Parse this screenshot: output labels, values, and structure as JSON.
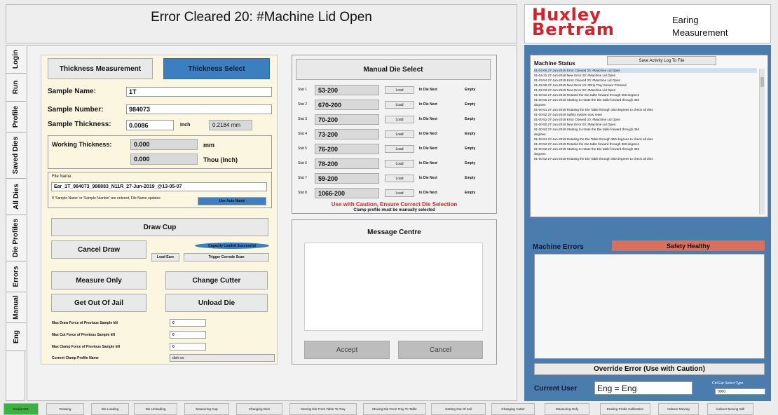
{
  "title": "Error Cleared 20: #Machine Lid Open",
  "logo": {
    "line1": "Huxley",
    "line2": "Bertram",
    "sub1": "Earing",
    "sub2": "Measurement"
  },
  "side_tabs": [
    "Login",
    "Run",
    "Profile",
    "Saved Dies",
    "All Dies",
    "Die Profiles",
    "Errors",
    "Manual",
    "Eng"
  ],
  "thickness": {
    "tab_measurement": "Thickness Measurement",
    "tab_select": "Thickness Select",
    "sample_name_label": "Sample Name:",
    "sample_name": "1T",
    "sample_number_label": "Sample Number:",
    "sample_number": "984073",
    "sample_thickness_label": "Sample Thickness:",
    "sample_thickness": "0.0086",
    "thickness_unit": "Inch",
    "thickness_mm": "0.2184 mm",
    "working_label": "Working Thickness:",
    "working_mm": "0.000",
    "working_mm_unit": "mm",
    "working_thou": "0.000",
    "working_thou_unit": "Thou (Inch)"
  },
  "file": {
    "label": "File Name",
    "value": "Ear_1T_984073_988883_N11R_27-Jun-2019_@13-05-07",
    "note": "If 'Sample Name' or 'Sample Number' are entered, File Name updates",
    "button": "Use Auto Name"
  },
  "actions": {
    "draw_cup": "Draw Cup",
    "cancel_draw": "Cancel Draw",
    "load_ears": "Load Ears",
    "capacity": "Capacity Loaded Successful",
    "trigger": "Trigger Corrode Scan",
    "measure_only": "Measure Only",
    "change_cutter": "Change Cutter",
    "get_out_of_jail": "Get Out Of Jail",
    "unload_die": "Unload Die"
  },
  "forces": [
    {
      "label": "Max Draw Force of Previous Sample kN",
      "value": "0"
    },
    {
      "label": "Max Cut Force of Previous Sample kN",
      "value": "0"
    },
    {
      "label": "Max Clamp Force of Previous Sample kN",
      "value": "0"
    },
    {
      "label": "Current Clamp Profile Name",
      "value": "dish cw"
    }
  ],
  "die": {
    "title": "Manual Die Select",
    "load_label": "Load",
    "indie_label": "In Die Next",
    "empty_label": "Empty",
    "stations": [
      {
        "station": "Stat 1",
        "value": "53-200"
      },
      {
        "station": "Stat 2",
        "value": "670-200"
      },
      {
        "station": "Stat 3",
        "value": "70-200"
      },
      {
        "station": "Stat 4",
        "value": "73-200"
      },
      {
        "station": "Stat 5",
        "value": "76-200"
      },
      {
        "station": "Stat 6",
        "value": "78-200"
      },
      {
        "station": "Stat 7",
        "value": "59-200"
      },
      {
        "station": "Stat 8",
        "value": "1066-200"
      }
    ],
    "caution": "Use with Caution, Ensure Correct Die Selection",
    "caution2": "Clamp profile must be manually selected"
  },
  "message": {
    "title": "Message Centre",
    "accept": "Accept",
    "cancel": "Cancel"
  },
  "status": {
    "title": "Machine Status",
    "log_button": "Save Activity Log To File",
    "log": [
      "01-04-05 27-Jun-2019  Error Cleared 20: #Machine Lid Open",
      "01-04-22 27-Jun-2019  New Error 20: #Machine Lid Open",
      "01-03-54 27-Jun-2019  Error Cleared 20: #Machine Lid Open",
      "01-02-58 27-Jun-2019  New Error 10: #Drip Tray Sensor Pressed",
      "01-02-03 27-Jun-2019  New Error 20: #Machine Lid Open",
      "01-00-52 27-Jun-2019  Rotated the Die table forward through 360 degrees",
      "01-00-50 27-Jun-2019  Starting to rotate the Die table forward through 360",
      "degrees",
      "01-00-51 27-Jun-2019  Rotating the Die Table through 360 degrees to check all dies",
      "01-00-52 27-Jun-2019  Safety system now reset",
      "01-00-52 27-Jun-2019  Error Cleared 20: #Machine Lid Open",
      "01-00-50 27-Jun-2019  New Error 20: #Machine Lid Open",
      "01-00-52 27-Jun-2019  Starting to rotate the Die table forward through 360",
      "degrees",
      "01-00-51 27-Jun-2019  Rotating the Die Table through 360 degrees to check all dies",
      "01-00-52 27-Jun-2019  Rotated the Die table forward through 360 degrees",
      "01-00-52 27-Jun-2019  Starting to rotate the Die table forward through 360",
      "degrees",
      "01-00-52 27-Jun-2019  Rotating the Die Table through 360 degrees to check all dies"
    ]
  },
  "errors": {
    "title": "Machine Errors",
    "status": "Safety Healthy",
    "override": "Override Error (Use with Caution)",
    "user_label": "Current User",
    "user": "Eng = Eng",
    "small_label": "Ctrl Ear Select Type",
    "small_value": "0000"
  },
  "bottom_tabs": [
    "Ready 001",
    "Drawing",
    "Die Loading",
    "Die Unloading",
    "Measuring Cup",
    "Changing Dies",
    "Moving Die From Table To Tray",
    "Moving Die From Tray To Table",
    "Getting Out Of Jail",
    "Changing Cutter",
    "Measuring Only",
    "Erasing Probe Calibration",
    "Indexer Moving",
    "Indexer Moving Still"
  ],
  "colors": {
    "accent_blue": "#3b7fc0",
    "panel_blue": "#4a7cae",
    "alert_red": "#d9705e",
    "logo_red": "#d8202a",
    "ready_green": "#3cb043"
  }
}
